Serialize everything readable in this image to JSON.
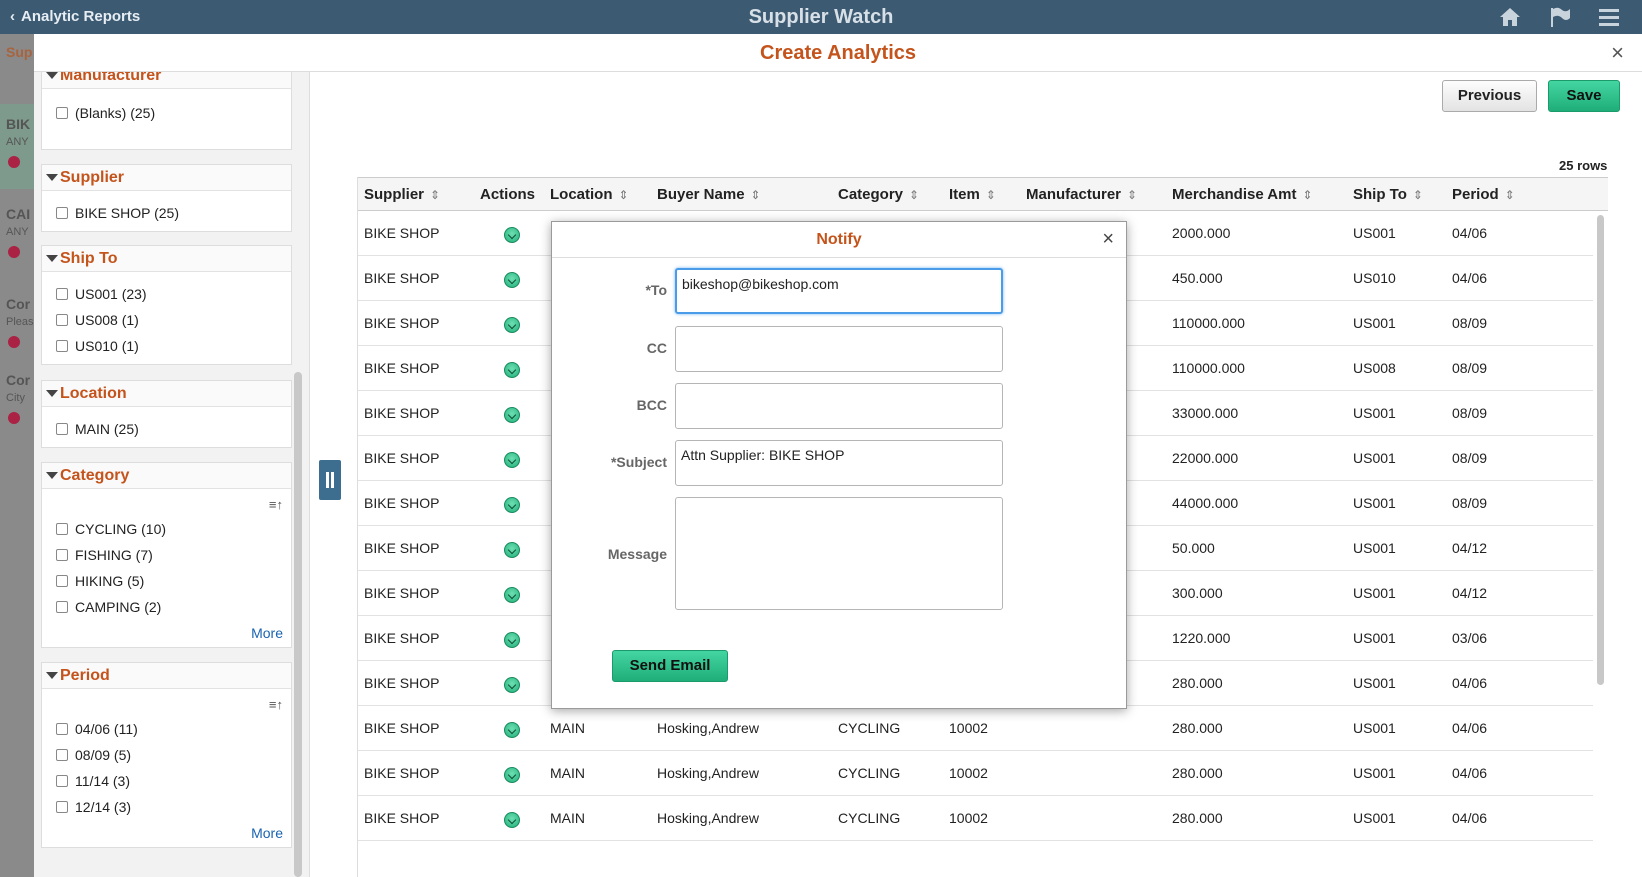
{
  "banner": {
    "back_label": "Analytic Reports",
    "title": "Supplier Watch",
    "icons": [
      "home-icon",
      "flag-icon",
      "menu-icon"
    ]
  },
  "background": {
    "header": "Sup",
    "items": [
      {
        "title": "BIK",
        "sub": "ANY"
      },
      {
        "title": "CAI",
        "sub": "ANY"
      },
      {
        "title": "Cor",
        "sub": "Pleas"
      },
      {
        "title": "Cor",
        "sub": "City"
      }
    ]
  },
  "modal": {
    "title": "Create Analytics",
    "close": "×"
  },
  "filters": {
    "partial_group": "Manufacturer",
    "manufacturer": {
      "options": [
        "(Blanks) (25)"
      ]
    },
    "supplier": {
      "name": "Supplier",
      "options": [
        "BIKE SHOP (25)"
      ]
    },
    "ship_to": {
      "name": "Ship To",
      "options": [
        "US001 (23)",
        "US008 (1)",
        "US010 (1)"
      ]
    },
    "location": {
      "name": "Location",
      "options": [
        "MAIN (25)"
      ]
    },
    "category": {
      "name": "Category",
      "options": [
        "CYCLING (10)",
        "FISHING (7)",
        "HIKING (5)",
        "CAMPING (2)"
      ],
      "more": "More"
    },
    "period": {
      "name": "Period",
      "options": [
        "04/06 (11)",
        "08/09 (5)",
        "11/14 (3)",
        "12/14 (3)"
      ],
      "more": "More"
    }
  },
  "toolbar": {
    "previous_label": "Previous",
    "save_label": "Save",
    "row_count": "25 rows"
  },
  "grid": {
    "columns": [
      "Supplier",
      "Actions",
      "Location",
      "Buyer Name",
      "Category",
      "Item",
      "Manufacturer",
      "Merchandise Amt",
      "Ship To",
      "Period"
    ],
    "rows": [
      {
        "supplier": "BIKE SHOP",
        "location": "",
        "buyer": "",
        "category": "",
        "item": "",
        "amt": "2000.000",
        "ship": "US001",
        "period": "04/06"
      },
      {
        "supplier": "BIKE SHOP",
        "location": "",
        "buyer": "",
        "category": "",
        "item": "",
        "amt": "450.000",
        "ship": "US010",
        "period": "04/06"
      },
      {
        "supplier": "BIKE SHOP",
        "location": "",
        "buyer": "",
        "category": "",
        "item": "",
        "amt": "110000.000",
        "ship": "US001",
        "period": "08/09"
      },
      {
        "supplier": "BIKE SHOP",
        "location": "",
        "buyer": "",
        "category": "",
        "item": "",
        "amt": "110000.000",
        "ship": "US008",
        "period": "08/09"
      },
      {
        "supplier": "BIKE SHOP",
        "location": "",
        "buyer": "",
        "category": "",
        "item": "",
        "amt": "33000.000",
        "ship": "US001",
        "period": "08/09"
      },
      {
        "supplier": "BIKE SHOP",
        "location": "",
        "buyer": "",
        "category": "",
        "item": "",
        "amt": "22000.000",
        "ship": "US001",
        "period": "08/09"
      },
      {
        "supplier": "BIKE SHOP",
        "location": "",
        "buyer": "",
        "category": "",
        "item": "",
        "amt": "44000.000",
        "ship": "US001",
        "period": "08/09"
      },
      {
        "supplier": "BIKE SHOP",
        "location": "",
        "buyer": "",
        "category": "",
        "item": "",
        "amt": "50.000",
        "ship": "US001",
        "period": "04/12"
      },
      {
        "supplier": "BIKE SHOP",
        "location": "",
        "buyer": "",
        "category": "",
        "item": "",
        "amt": "300.000",
        "ship": "US001",
        "period": "04/12"
      },
      {
        "supplier": "BIKE SHOP",
        "location": "",
        "buyer": "",
        "category": "",
        "item": "",
        "amt": "1220.000",
        "ship": "US001",
        "period": "03/06"
      },
      {
        "supplier": "BIKE SHOP",
        "location": "",
        "buyer": "",
        "category": "",
        "item": "",
        "amt": "280.000",
        "ship": "US001",
        "period": "04/06"
      },
      {
        "supplier": "BIKE SHOP",
        "location": "MAIN",
        "buyer": "Hosking,Andrew",
        "category": "CYCLING",
        "item": "10002",
        "amt": "280.000",
        "ship": "US001",
        "period": "04/06"
      },
      {
        "supplier": "BIKE SHOP",
        "location": "MAIN",
        "buyer": "Hosking,Andrew",
        "category": "CYCLING",
        "item": "10002",
        "amt": "280.000",
        "ship": "US001",
        "period": "04/06"
      },
      {
        "supplier": "BIKE SHOP",
        "location": "MAIN",
        "buyer": "Hosking,Andrew",
        "category": "CYCLING",
        "item": "10002",
        "amt": "280.000",
        "ship": "US001",
        "period": "04/06"
      }
    ]
  },
  "notify": {
    "title": "Notify",
    "close": "×",
    "to_label": "*To",
    "to_value": "bikeshop@bikeshop.com",
    "cc_label": "CC",
    "cc_value": "",
    "bcc_label": "BCC",
    "bcc_value": "",
    "subject_label": "*Subject",
    "subject_value": "Attn Supplier: BIKE SHOP",
    "message_label": "Message",
    "message_value": "",
    "send_label": "Send Email"
  }
}
